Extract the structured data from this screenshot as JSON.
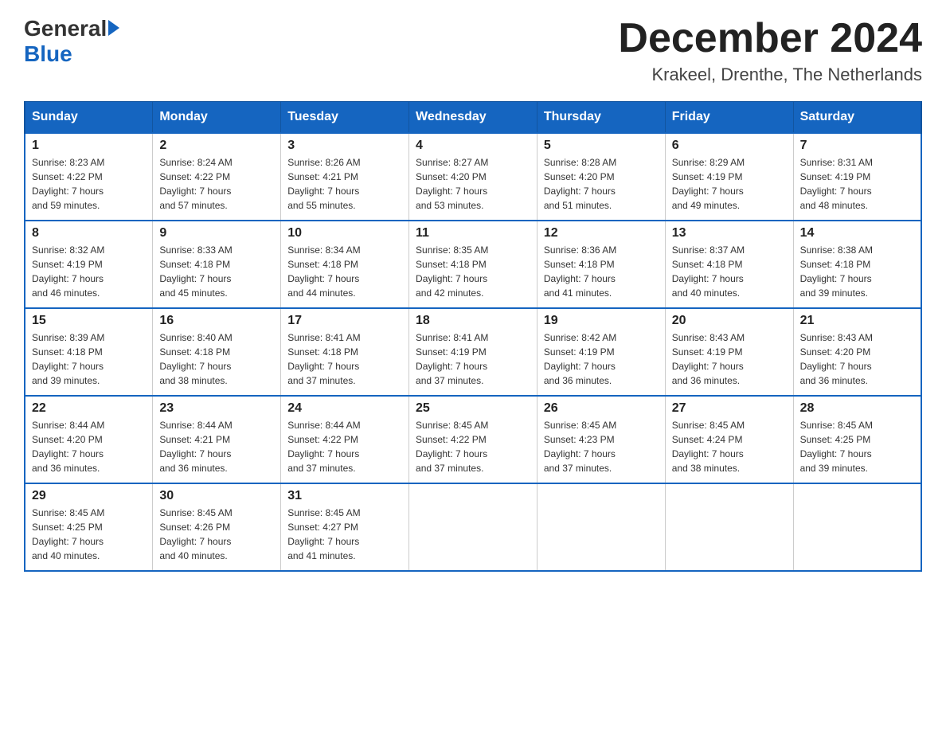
{
  "header": {
    "logo_general": "General",
    "logo_blue": "Blue",
    "month_title": "December 2024",
    "location": "Krakeel, Drenthe, The Netherlands"
  },
  "days_of_week": [
    "Sunday",
    "Monday",
    "Tuesday",
    "Wednesday",
    "Thursday",
    "Friday",
    "Saturday"
  ],
  "weeks": [
    [
      {
        "day": "1",
        "sunrise": "8:23 AM",
        "sunset": "4:22 PM",
        "daylight": "7 hours and 59 minutes."
      },
      {
        "day": "2",
        "sunrise": "8:24 AM",
        "sunset": "4:22 PM",
        "daylight": "7 hours and 57 minutes."
      },
      {
        "day": "3",
        "sunrise": "8:26 AM",
        "sunset": "4:21 PM",
        "daylight": "7 hours and 55 minutes."
      },
      {
        "day": "4",
        "sunrise": "8:27 AM",
        "sunset": "4:20 PM",
        "daylight": "7 hours and 53 minutes."
      },
      {
        "day": "5",
        "sunrise": "8:28 AM",
        "sunset": "4:20 PM",
        "daylight": "7 hours and 51 minutes."
      },
      {
        "day": "6",
        "sunrise": "8:29 AM",
        "sunset": "4:19 PM",
        "daylight": "7 hours and 49 minutes."
      },
      {
        "day": "7",
        "sunrise": "8:31 AM",
        "sunset": "4:19 PM",
        "daylight": "7 hours and 48 minutes."
      }
    ],
    [
      {
        "day": "8",
        "sunrise": "8:32 AM",
        "sunset": "4:19 PM",
        "daylight": "7 hours and 46 minutes."
      },
      {
        "day": "9",
        "sunrise": "8:33 AM",
        "sunset": "4:18 PM",
        "daylight": "7 hours and 45 minutes."
      },
      {
        "day": "10",
        "sunrise": "8:34 AM",
        "sunset": "4:18 PM",
        "daylight": "7 hours and 44 minutes."
      },
      {
        "day": "11",
        "sunrise": "8:35 AM",
        "sunset": "4:18 PM",
        "daylight": "7 hours and 42 minutes."
      },
      {
        "day": "12",
        "sunrise": "8:36 AM",
        "sunset": "4:18 PM",
        "daylight": "7 hours and 41 minutes."
      },
      {
        "day": "13",
        "sunrise": "8:37 AM",
        "sunset": "4:18 PM",
        "daylight": "7 hours and 40 minutes."
      },
      {
        "day": "14",
        "sunrise": "8:38 AM",
        "sunset": "4:18 PM",
        "daylight": "7 hours and 39 minutes."
      }
    ],
    [
      {
        "day": "15",
        "sunrise": "8:39 AM",
        "sunset": "4:18 PM",
        "daylight": "7 hours and 39 minutes."
      },
      {
        "day": "16",
        "sunrise": "8:40 AM",
        "sunset": "4:18 PM",
        "daylight": "7 hours and 38 minutes."
      },
      {
        "day": "17",
        "sunrise": "8:41 AM",
        "sunset": "4:18 PM",
        "daylight": "7 hours and 37 minutes."
      },
      {
        "day": "18",
        "sunrise": "8:41 AM",
        "sunset": "4:19 PM",
        "daylight": "7 hours and 37 minutes."
      },
      {
        "day": "19",
        "sunrise": "8:42 AM",
        "sunset": "4:19 PM",
        "daylight": "7 hours and 36 minutes."
      },
      {
        "day": "20",
        "sunrise": "8:43 AM",
        "sunset": "4:19 PM",
        "daylight": "7 hours and 36 minutes."
      },
      {
        "day": "21",
        "sunrise": "8:43 AM",
        "sunset": "4:20 PM",
        "daylight": "7 hours and 36 minutes."
      }
    ],
    [
      {
        "day": "22",
        "sunrise": "8:44 AM",
        "sunset": "4:20 PM",
        "daylight": "7 hours and 36 minutes."
      },
      {
        "day": "23",
        "sunrise": "8:44 AM",
        "sunset": "4:21 PM",
        "daylight": "7 hours and 36 minutes."
      },
      {
        "day": "24",
        "sunrise": "8:44 AM",
        "sunset": "4:22 PM",
        "daylight": "7 hours and 37 minutes."
      },
      {
        "day": "25",
        "sunrise": "8:45 AM",
        "sunset": "4:22 PM",
        "daylight": "7 hours and 37 minutes."
      },
      {
        "day": "26",
        "sunrise": "8:45 AM",
        "sunset": "4:23 PM",
        "daylight": "7 hours and 37 minutes."
      },
      {
        "day": "27",
        "sunrise": "8:45 AM",
        "sunset": "4:24 PM",
        "daylight": "7 hours and 38 minutes."
      },
      {
        "day": "28",
        "sunrise": "8:45 AM",
        "sunset": "4:25 PM",
        "daylight": "7 hours and 39 minutes."
      }
    ],
    [
      {
        "day": "29",
        "sunrise": "8:45 AM",
        "sunset": "4:25 PM",
        "daylight": "7 hours and 40 minutes."
      },
      {
        "day": "30",
        "sunrise": "8:45 AM",
        "sunset": "4:26 PM",
        "daylight": "7 hours and 40 minutes."
      },
      {
        "day": "31",
        "sunrise": "8:45 AM",
        "sunset": "4:27 PM",
        "daylight": "7 hours and 41 minutes."
      },
      null,
      null,
      null,
      null
    ]
  ],
  "labels": {
    "sunrise": "Sunrise:",
    "sunset": "Sunset:",
    "daylight": "Daylight:"
  }
}
